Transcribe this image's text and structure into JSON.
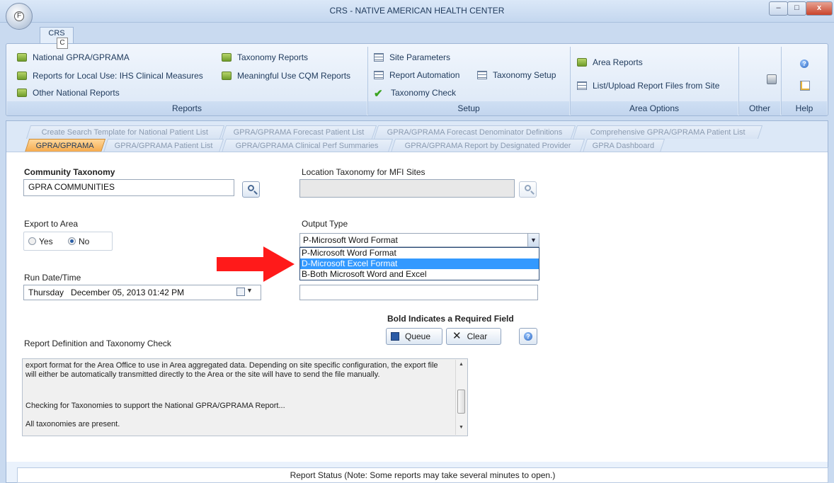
{
  "window": {
    "title": "CRS - NATIVE AMERICAN HEALTH CENTER",
    "min": "–",
    "max": "□",
    "close": "x"
  },
  "app_button": {
    "letter": "F"
  },
  "ribbon": {
    "tab_label": "CRS",
    "tab_key_tip": "C",
    "reports": {
      "label": "Reports",
      "items": [
        "National GPRA/GPRAMA",
        "Reports for Local Use: IHS Clinical Measures",
        "Other National Reports",
        "Taxonomy Reports",
        "Meaningful Use CQM Reports"
      ]
    },
    "setup": {
      "label": "Setup",
      "items": [
        "Site Parameters",
        "Report Automation",
        "Taxonomy Setup",
        "Taxonomy Check"
      ]
    },
    "area_options": {
      "label": "Area Options",
      "items": [
        "Area Reports",
        "List/Upload Report Files from Site"
      ]
    },
    "other": {
      "label": "Other"
    },
    "help": {
      "label": "Help",
      "icon_glyph": "?"
    }
  },
  "tabs": {
    "row1": [
      "Create Search Template for National Patient List",
      "GPRA/GPRAMA Forecast Patient List",
      "GPRA/GPRAMA Forecast Denominator Definitions",
      "Comprehensive GPRA/GPRAMA Patient List"
    ],
    "row2": [
      "GPRA/GPRAMA",
      "GPRA/GPRAMA Patient List",
      "GPRA/GPRAMA Clinical Perf Summaries",
      "GPRA/GPRAMA Report by Designated Provider",
      "GPRA Dashboard"
    ]
  },
  "form": {
    "community_taxonomy_label": "Community Taxonomy",
    "community_taxonomy_value": "GPRA COMMUNITIES",
    "location_taxonomy_label": "Location Taxonomy for MFI Sites",
    "location_taxonomy_value": "",
    "export_label": "Export to Area",
    "export_yes": "Yes",
    "export_no": "No",
    "export_selected": "No",
    "output_type_label": "Output Type",
    "output_type_value": "P-Microsoft Word Format",
    "output_options": [
      "P-Microsoft Word Format",
      "D-Microsoft Excel Format",
      "B-Both Microsoft Word and Excel"
    ],
    "output_highlighted": "D-Microsoft Excel Format",
    "run_date_label": "Run Date/Time",
    "run_date_day": "Thursday",
    "run_date_value": "December 05, 2013  01:42 PM",
    "required_note": "Bold Indicates a Required Field",
    "queue_label": "Queue",
    "clear_label": "Clear",
    "report_def_label": "Report Definition and Taxonomy Check",
    "report_def_text": [
      "export format for the Area Office to use in Area aggregated data. Depending on site specific configuration, the export file",
      "will either be automatically transmitted directly to the Area or the site will have to send the file manually.",
      "",
      "",
      "Checking for Taxonomies to support the National GPRA/GPRAMA Report...",
      "",
      "All taxonomies are present."
    ]
  },
  "status_bar": {
    "text": "Report Status   (Note: Some reports may take several minutes to open.)"
  },
  "colors": {
    "annotation_arrow": "#ff1a1a",
    "active_tab": "#f4a84a",
    "highlight": "#3399ff"
  }
}
